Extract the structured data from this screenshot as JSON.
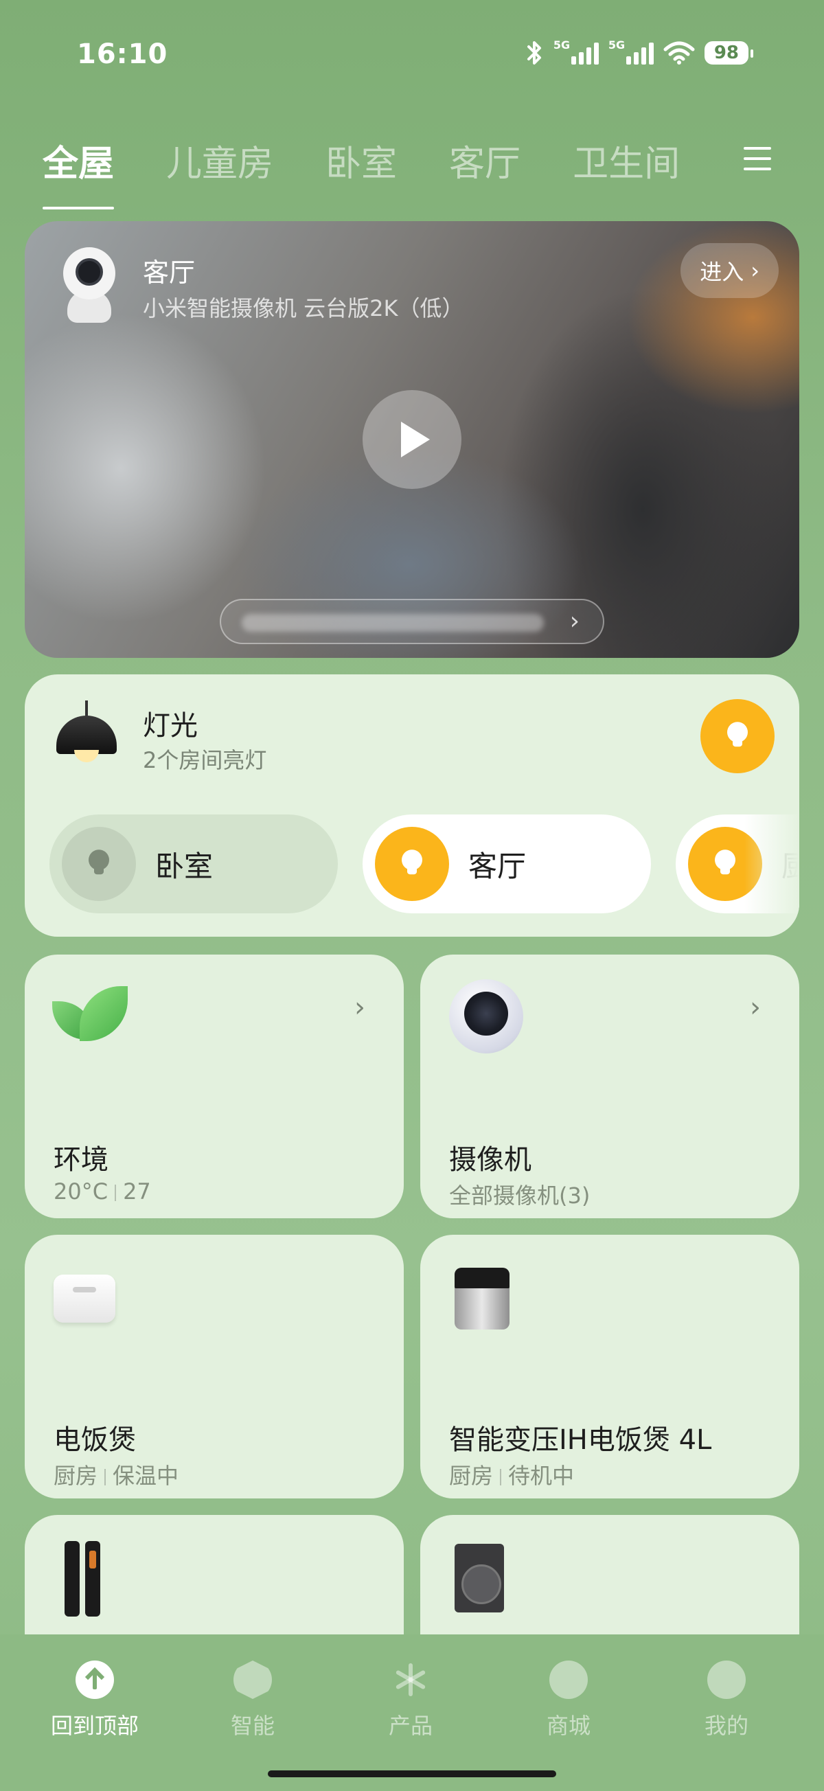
{
  "status_bar": {
    "time": "16:10",
    "network_1": "5G",
    "network_2": "5G",
    "battery": "98",
    "icons": [
      "bluetooth-icon",
      "signal-icon",
      "signal-icon",
      "wifi-icon",
      "battery-icon"
    ]
  },
  "tabs": [
    {
      "label": "全屋",
      "active": true
    },
    {
      "label": "儿童房",
      "active": false
    },
    {
      "label": "卧室",
      "active": false
    },
    {
      "label": "客厅",
      "active": false
    },
    {
      "label": "卫生间",
      "active": false
    }
  ],
  "camera_card": {
    "room": "客厅",
    "model": "小米智能摄像机 云台版2K（低）",
    "enter_label": "进入",
    "enter_chevron": "›",
    "banner_chevron": "›"
  },
  "lights": {
    "title": "灯光",
    "subtitle": "2个房间亮灯",
    "rooms": [
      {
        "label": "卧室",
        "state": "off"
      },
      {
        "label": "客厅",
        "state": "on"
      },
      {
        "label": "厨",
        "state": "on"
      }
    ]
  },
  "devices": [
    {
      "name": "环境",
      "status_a": "20°C",
      "status_b": "27",
      "chevron": "›",
      "icon": "leaf-icon"
    },
    {
      "name": "摄像机",
      "status_a": "全部摄像机(3)",
      "chevron": "›",
      "icon": "camera-icon"
    },
    {
      "name": "电饭煲",
      "status_a": "厨房",
      "status_b": "保温中",
      "icon": "rice-cooker-icon"
    },
    {
      "name": "智能变压IH电饭煲 4L",
      "status_a": "厨房",
      "status_b": "待机中",
      "icon": "rice-cooker-icon"
    },
    {
      "name": "",
      "icon": "door-lock-icon"
    },
    {
      "name": "",
      "icon": "washing-machine-icon"
    }
  ],
  "bottom_nav": [
    {
      "label": "回到顶部",
      "icon": "back-to-top-icon",
      "active": true
    },
    {
      "label": "智能",
      "icon": "smart-icon",
      "active": false
    },
    {
      "label": "产品",
      "icon": "products-icon",
      "active": false
    },
    {
      "label": "商城",
      "icon": "store-icon",
      "active": false
    },
    {
      "label": "我的",
      "icon": "profile-icon",
      "active": false
    }
  ],
  "colors": {
    "accent_yellow": "#fbb51b",
    "background_green": "#8fbb86",
    "card_bg": "#e3f1de"
  }
}
